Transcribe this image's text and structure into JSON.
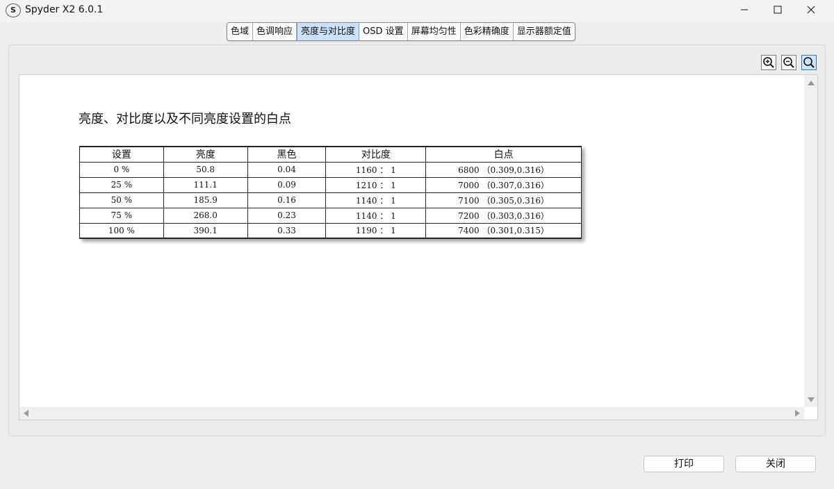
{
  "window": {
    "title": "Spyder X2 6.0.1",
    "logo_letter": "S"
  },
  "tabs": [
    {
      "label": "色域",
      "active": false
    },
    {
      "label": "色调响应",
      "active": false
    },
    {
      "label": "亮度与对比度",
      "active": true
    },
    {
      "label": "OSD 设置",
      "active": false
    },
    {
      "label": "屏幕均匀性",
      "active": false
    },
    {
      "label": "色彩精确度",
      "active": false
    },
    {
      "label": "显示器额定值",
      "active": false
    }
  ],
  "zoom_buttons": [
    {
      "icon": "zoom-in-icon",
      "selected": false
    },
    {
      "icon": "zoom-out-icon",
      "selected": false
    },
    {
      "icon": "zoom-fit-icon",
      "selected": true
    }
  ],
  "report": {
    "title": "亮度、对比度以及不同亮度设置的白点",
    "table": {
      "headers": [
        "设置",
        "亮度",
        "黑色",
        "对比度",
        "白点"
      ],
      "rows": [
        [
          "0 %",
          "50.8",
          "0.04",
          "1160 ： 1",
          "6800 （0.309,0.316）"
        ],
        [
          "25 %",
          "111.1",
          "0.09",
          "1210 ： 1",
          "7000 （0.307,0.316）"
        ],
        [
          "50 %",
          "185.9",
          "0.16",
          "1140 ： 1",
          "7100 （0.305,0.316）"
        ],
        [
          "75 %",
          "268.0",
          "0.23",
          "1140 ： 1",
          "7200 （0.303,0.316）"
        ],
        [
          "100 %",
          "390.1",
          "0.33",
          "1190 ： 1",
          "7400 （0.301,0.315）"
        ]
      ]
    }
  },
  "buttons": {
    "print_label": "打印",
    "close_label": "关闭"
  },
  "colors": {
    "active_tab": "#cce0f7",
    "active_tab_border": "#6e9bd1",
    "selected_zoom": "#cde3f9"
  }
}
